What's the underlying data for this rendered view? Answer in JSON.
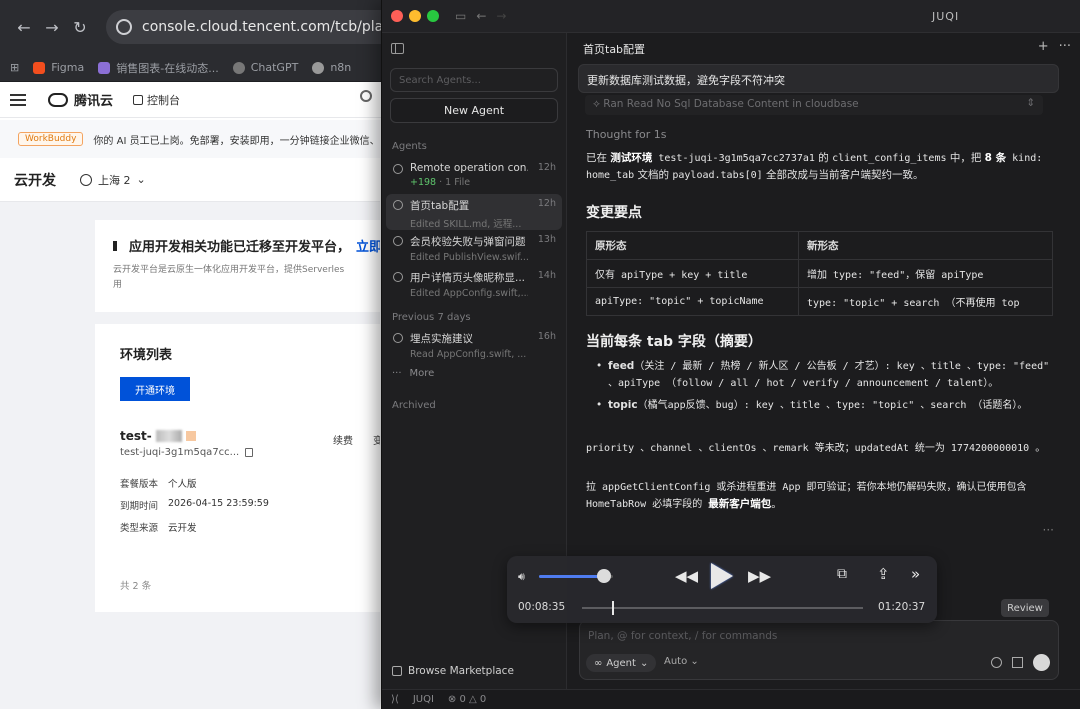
{
  "browser": {
    "url": "console.cloud.tencent.com/tcb/platform/e",
    "bookmarks": [
      "Figma",
      "销售图表-在线动态...",
      "ChatGPT",
      "n8n"
    ],
    "brand": "腾讯云",
    "console_label": "控制台",
    "announcement_tag": "WorkBuddy",
    "announcement_text": "你的 AI 员工已上岗。免部署，安装即用，一分钟链接企业微信、Q",
    "section_title": "云开发",
    "region": "上海 2",
    "notice_title": "应用开发相关功能已迁移至开发平台，",
    "notice_link": "立即",
    "notice_desc_1": "云开发平台是云原生一体化应用开发平台，提供Serverles",
    "notice_desc_2": "用",
    "env_list_title": "环境列表",
    "open_env_button": "开通环境",
    "env": {
      "name_prefix": "test-",
      "id": "test-juqi-3g1m5qa7cc...",
      "actions": [
        "续费",
        "变"
      ],
      "fields": [
        {
          "k": "套餐版本",
          "v": "个人版"
        },
        {
          "k": "到期时间",
          "v": "2026-04-15 23:59:59"
        },
        {
          "k": "类型来源",
          "v": "云开发"
        }
      ]
    },
    "total": "共 2 条"
  },
  "app": {
    "title": "JUQI",
    "search_placeholder": "Search Agents...",
    "new_agent": "New Agent",
    "agents_section": "Agents",
    "previous_section": "Previous 7 days",
    "archived_section": "Archived",
    "more": "More",
    "marketplace": "Browse Marketplace",
    "agents": [
      {
        "name": "Remote operation con...",
        "sub_plus": "+198",
        "sub": " · 1 File",
        "time": "12h"
      },
      {
        "name": "首页tab配置",
        "sub_plus": "",
        "sub": "Edited SKILL.md, 远程...",
        "time": "12h"
      },
      {
        "name": "会员校验失败与弹窗问题",
        "sub_plus": "",
        "sub": "Edited PublishView.swif...",
        "time": "13h"
      },
      {
        "name": "用户详情页头像昵称显...",
        "sub_plus": "",
        "sub": "Edited AppConfig.swift,...",
        "time": "14h"
      }
    ],
    "previous_agents": [
      {
        "name": "埋点实施建议",
        "sub": "Read AppConfig.swift, ...",
        "time": "16h"
      }
    ],
    "status": {
      "name": "JUQI",
      "errors": "0",
      "warnings": "0"
    },
    "chat": {
      "header": "首页tab配置",
      "user_message": "更新数据库测试数据，避免字段不符冲突",
      "tool_call": "Ran Read No Sql Database Content in cloudbase",
      "thought": "Thought for 1s",
      "p1_a": "已在 ",
      "p1_b": "测试环境",
      "p1_c": " test-juqi-3g1m5qa7cc2737a1",
      "p1_d": " 的 ",
      "p1_e": "client_config_items",
      "p1_f": " 中，把 ",
      "p1_g": "8 条",
      "p1_h": " kind: home_tab",
      "p1_i": " 文档的 ",
      "p1_j": "payload.tabs[0]",
      "p1_k": " 全部改成与当前客户端契约一致。",
      "h_changes": "变更要点",
      "table": {
        "head": [
          "原形态",
          "新形态"
        ],
        "rows": [
          [
            "仅有 apiType + key + title",
            "增加 type: \"feed\"，保留 apiType"
          ],
          [
            "apiType: \"topic\" + topicName",
            "type: \"topic\" + search （不再使用 top"
          ]
        ]
      },
      "h_fields": "当前每条 tab 字段（摘要）",
      "b1_label": "feed",
      "b1_text": "（关注 / 最新 / 热榜 / 新人区 / 公告板 / 才艺）: key 、title 、type: \"feed\" 、apiType （follow / all / hot / verify / announcement / talent）。",
      "b2_label": "topic",
      "b2_text": "（橘气app反馈、bug）: key 、title 、type: \"topic\" 、search （话题名）。",
      "p2": "priority 、channel 、clientOs 、remark 等未改；updatedAt 统一为 1774200000010 。",
      "p3_a": "拉 appGetClientConfig 或杀进程重进 App 即可验证；若你本地仍解码失败，确认已使用包含 HomeTabRow 必填字段的 ",
      "p3_b": "最新客户端包",
      "p3_c": "。",
      "review": "Review",
      "composer_placeholder": "Plan, @ for context, / for commands",
      "mode": "Agent",
      "auto": "Auto"
    }
  },
  "player": {
    "elapsed": "00:08:35",
    "total": "01:20:37",
    "volume": 0.88,
    "progress": 0.107
  },
  "colors": {
    "accent_blue": "#0052d9",
    "player_accent": "#4f7cf0",
    "traffic_red": "#fe5f57",
    "traffic_yellow": "#febc2e",
    "traffic_green": "#28c840"
  }
}
